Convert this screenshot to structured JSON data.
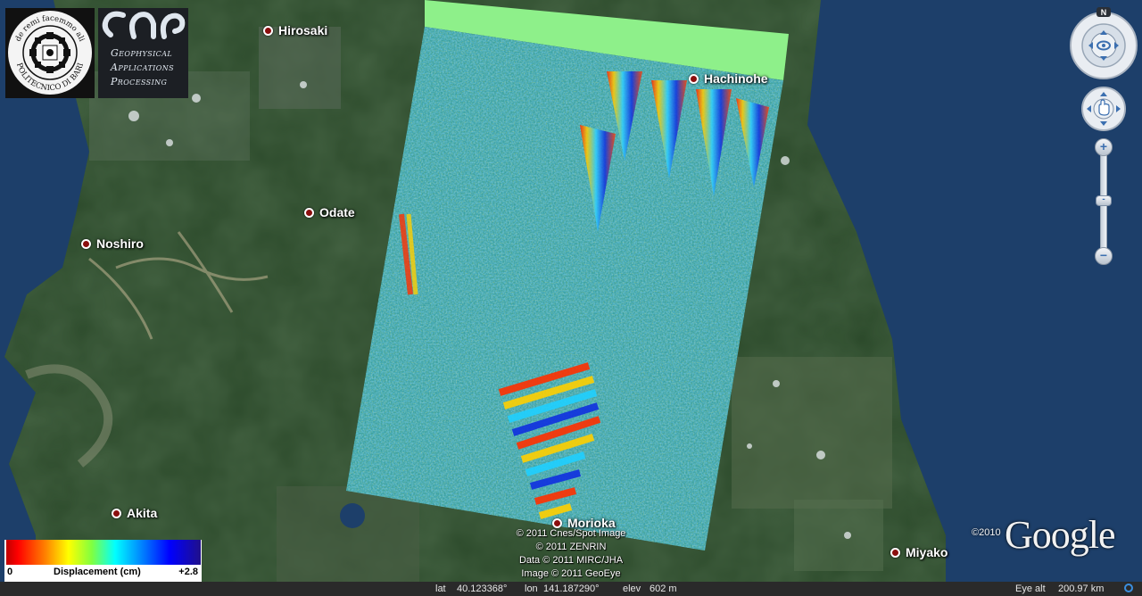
{
  "cities": [
    {
      "name": "Hirosaki"
    },
    {
      "name": "Hachinohe"
    },
    {
      "name": "Odate"
    },
    {
      "name": "Noshiro"
    },
    {
      "name": "Akita"
    },
    {
      "name": "Morioka"
    },
    {
      "name": "Miyako"
    }
  ],
  "logos": {
    "left_seal_text": [
      "de remi facemmo ali",
      "POLITECNICO DI BARI"
    ],
    "right": {
      "lines": [
        "Geophysical",
        "Applications",
        "Processing"
      ]
    }
  },
  "copyrights": [
    "© 2011 Cnes/Spot Image",
    "© 2011 ZENRIN",
    "Data © 2011 MIRC/JHA",
    "Image © 2011 GeoEye"
  ],
  "google": {
    "year": "©2010",
    "word": "Google"
  },
  "status_bar": {
    "lat_label": "lat",
    "lat_value": "40.123368°",
    "lon_label": "lon",
    "lon_value": "141.187290°",
    "elev_label": "elev",
    "elev_value": "602 m",
    "eye_label": "Eye alt",
    "eye_value": "200.97 km"
  },
  "legend": {
    "min": "0",
    "title": "Displacement (cm)",
    "max": "+2.8",
    "colors": [
      "#c00000",
      "#ff0000",
      "#ff8000",
      "#ffff00",
      "#80ff40",
      "#00ffff",
      "#0080ff",
      "#0000ff",
      "#20108a"
    ]
  },
  "navigation": {
    "north_label": "N",
    "zoom_in": "+",
    "zoom_out": "−"
  },
  "colors": {
    "sea": "#1d3f6a",
    "land": "#2c4a2b",
    "overlay_nodata": "#8ef08a"
  }
}
